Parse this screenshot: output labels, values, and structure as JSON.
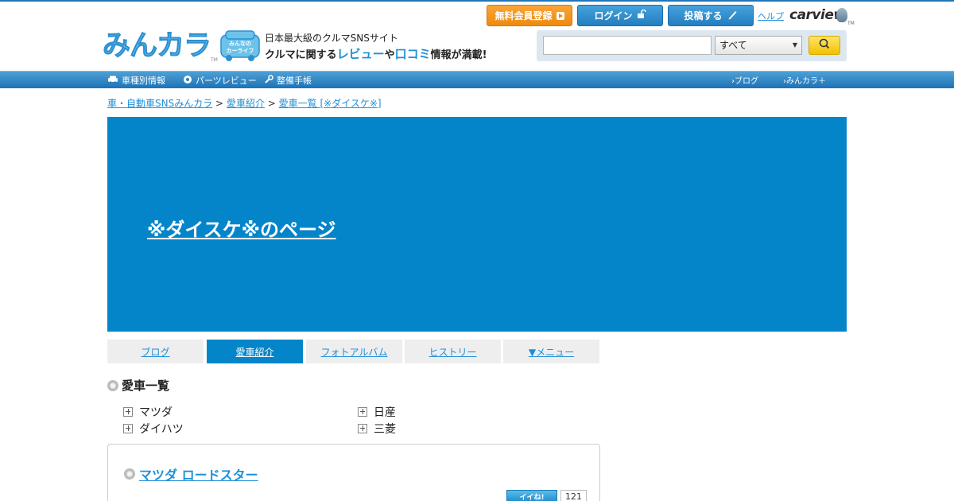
{
  "header": {
    "logo_text": "みんカラ",
    "logo_tm": "TM",
    "badge_text": "みんなのカーライフ",
    "tagline_top": "日本最大級のクルマSNSサイト",
    "tagline_pre": "クルマに関する",
    "tagline_hl1": "レビュー",
    "tagline_mid": "や",
    "tagline_hl2": "口コミ",
    "tagline_post": "情報が満載!",
    "btn_register": "無料会員登録",
    "btn_login": "ログイン",
    "btn_post": "投稿する",
    "help": "ヘルプ",
    "carview": "carview",
    "carview_tm": "TM"
  },
  "search": {
    "value": "",
    "category_selected": "すべて"
  },
  "nav": {
    "items": [
      "車種別情報",
      "パーツレビュー",
      "整備手帳"
    ],
    "right": [
      "ブログ",
      "みんカラ＋"
    ]
  },
  "breadcrumb": {
    "home": "車・自動車SNSみんカラ",
    "sep": ">",
    "level2": "愛車紹介",
    "level3": "愛車一覧 [※ダイスケ※]"
  },
  "hero": {
    "title": "※ダイスケ※のページ"
  },
  "tabs": [
    "ブログ",
    "愛車紹介",
    "フォトアルバム",
    "ヒストリー",
    "▼メニュー"
  ],
  "active_tab": "愛車紹介",
  "section": {
    "title": "愛車一覧",
    "makers": [
      "マツダ",
      "日産",
      "ダイハツ",
      "三菱"
    ]
  },
  "car": {
    "name": "マツダ ロードスター",
    "iine_label": "イイね!",
    "iine_count": "121"
  },
  "colors": {
    "accent_blue": "#0585c9",
    "link_blue": "#1e8fd8",
    "register_orange": "#ee8a0c",
    "search_yellow": "#f2c200"
  }
}
